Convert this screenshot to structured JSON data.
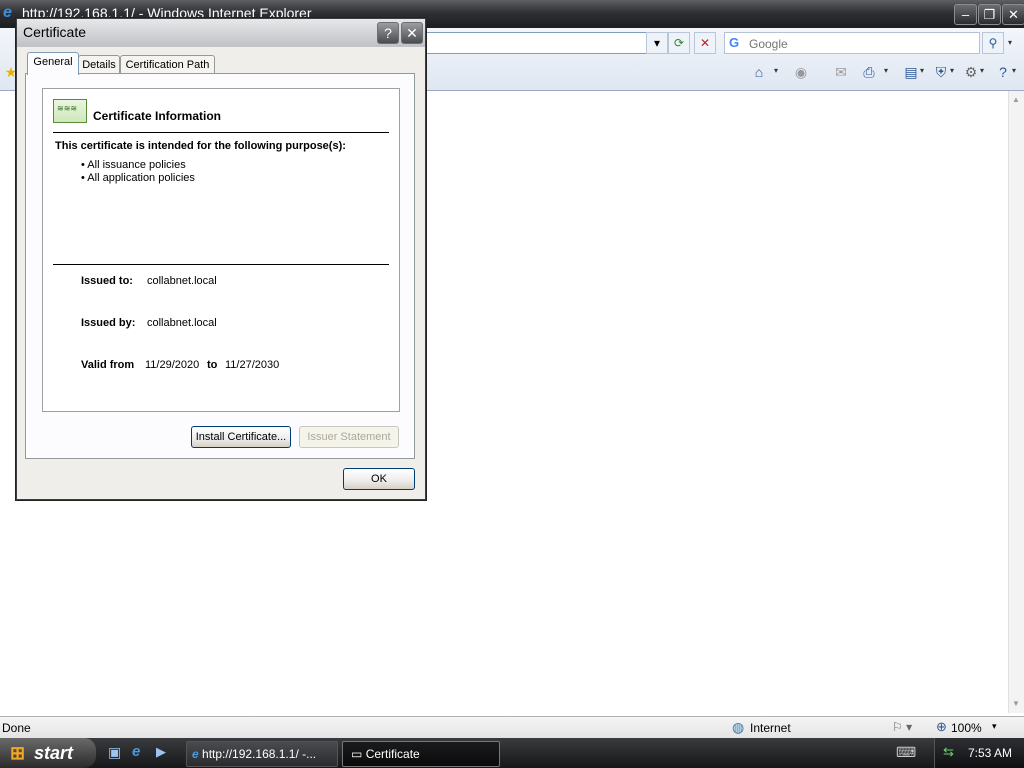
{
  "browser": {
    "title": "http://192.168.1.1/ - Windows Internet Explorer",
    "search_placeholder": "Google",
    "search_logo": "G"
  },
  "status": {
    "text": "Done",
    "zone": "Internet",
    "zoom": "100%"
  },
  "taskbar": {
    "start_label": "start",
    "tasks": [
      "http://192.168.1.1/ -...",
      "Certificate"
    ],
    "clock": "7:53 AM"
  },
  "dialog": {
    "title": "Certificate",
    "tabs": [
      "General",
      "Details",
      "Certification Path"
    ],
    "heading": "Certificate Information",
    "purpose_title": "This certificate is intended for the following purpose(s):",
    "purposes": [
      "• All issuance policies",
      "• All application policies"
    ],
    "issued_to_label": "Issued to:",
    "issued_to": "collabnet.local",
    "issued_by_label": "Issued by:",
    "issued_by": "collabnet.local",
    "valid_from_label": "Valid from",
    "valid_from": "11/29/2020",
    "valid_to_label": "to",
    "valid_to": "11/27/2030",
    "install_button": "Install Certificate...",
    "issuer_button": "Issuer Statement",
    "ok_button": "OK"
  }
}
